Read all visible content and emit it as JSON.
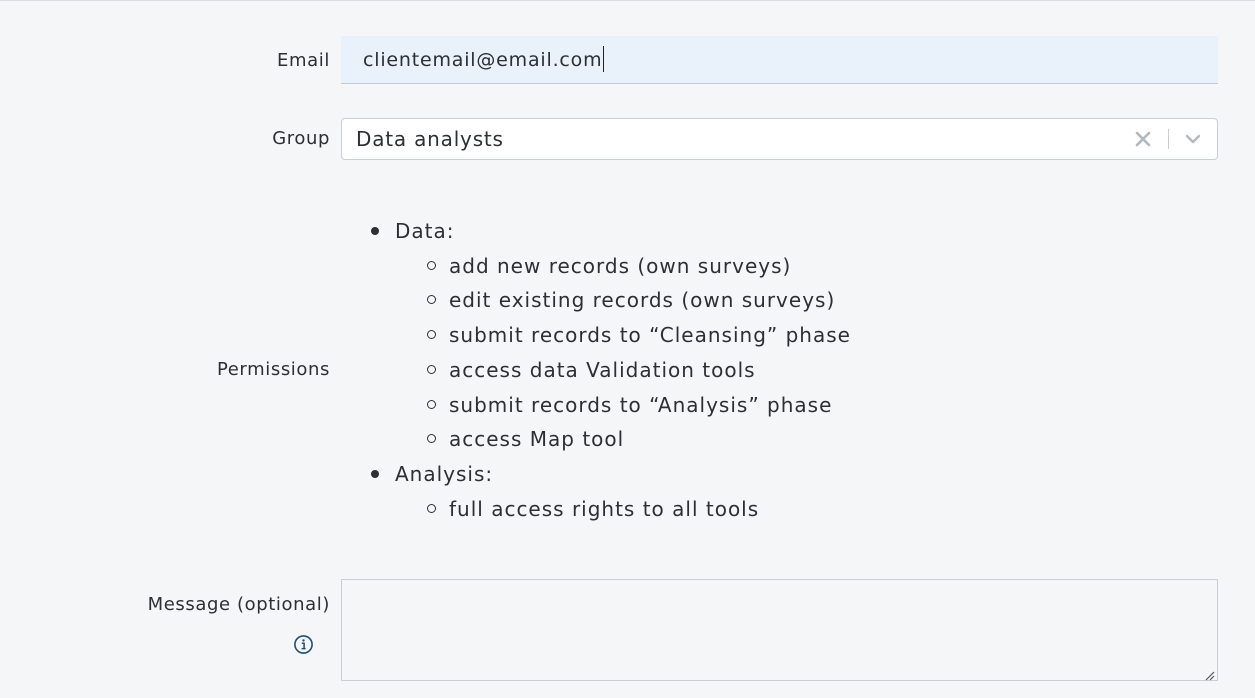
{
  "form": {
    "email": {
      "label": "Email",
      "value": "clientemail@email.com"
    },
    "group": {
      "label": "Group",
      "selected": "Data analysts"
    },
    "permissions": {
      "label": "Permissions",
      "items": [
        {
          "title": "Data:",
          "children": [
            "add new records (own surveys)",
            "edit existing records (own surveys)",
            "submit records to “Cleansing” phase",
            "access data Validation tools",
            "submit records to “Analysis” phase",
            "access Map tool"
          ]
        },
        {
          "title": "Analysis:",
          "children": [
            "full access rights to all tools"
          ]
        }
      ]
    },
    "message": {
      "label": "Message (optional)",
      "value": ""
    }
  },
  "icons": {
    "clear": "close-icon",
    "dropdown": "chevron-down-icon",
    "info": "info-icon",
    "resize": "resize-handle-icon"
  }
}
